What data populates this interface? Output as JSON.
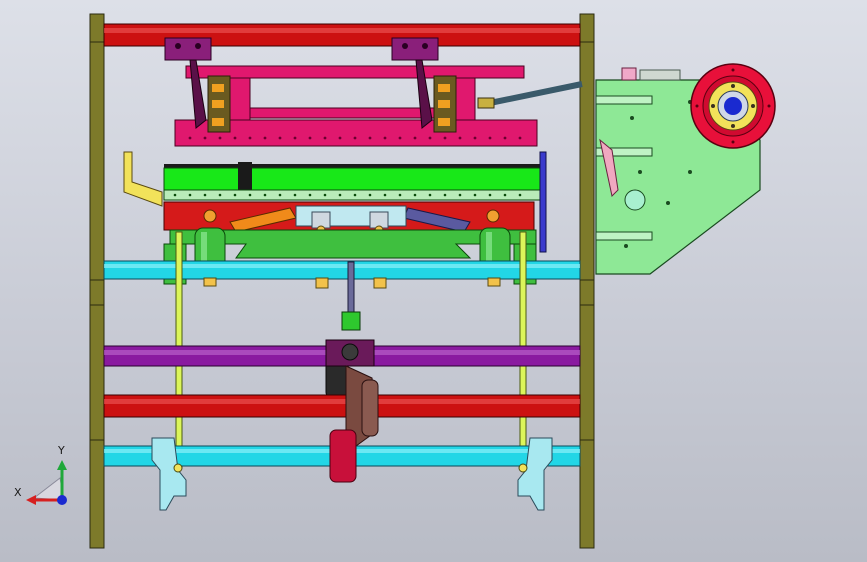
{
  "viewport": {
    "background_top": "#dde0e8",
    "background_bottom": "#b9bcc6"
  },
  "triad": {
    "x_label": "X",
    "y_label": "Y",
    "x_color": "#d62020",
    "y_color": "#1fa83a",
    "z_color": "#1a2ad0"
  },
  "colors": {
    "frame": "#7d7a2a",
    "bar_red": "#cc1111",
    "bar_cyan": "#22d6e6",
    "bar_purple": "#8a1aa0",
    "carriage_magenta": "#e0186e",
    "bracket_purple": "#8a1f7a",
    "plate_green": "#18e818",
    "rail_red": "#d51a1a",
    "mount_green": "#8ee896",
    "pulley_red": "#e8103a",
    "hub_yellow": "#f2e25a",
    "rod_lime": "#dcf55a",
    "roller_green": "#3fbf3f",
    "orange_part": "#f08a1a"
  }
}
